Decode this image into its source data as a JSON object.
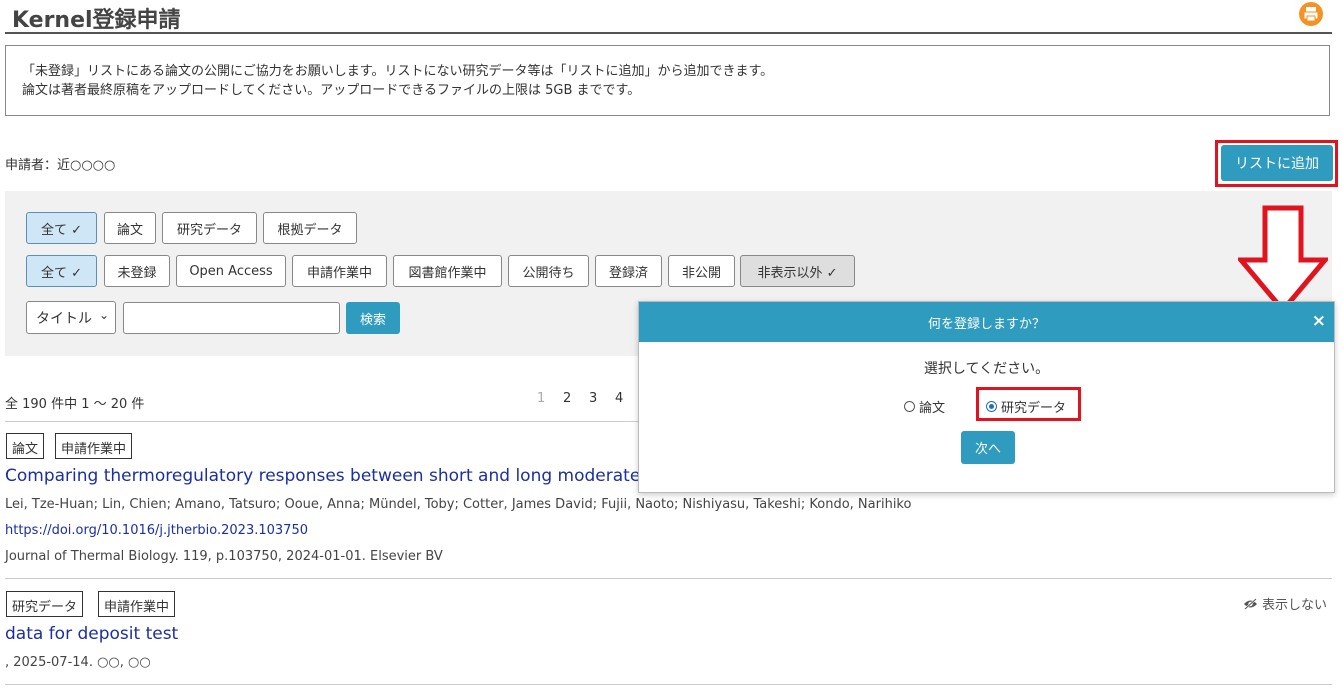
{
  "header": {
    "title": "Kernel登録申請",
    "print_icon": "print-icon"
  },
  "notice": {
    "line1": "「未登録」リストにある論文の公開にご協力をお願いします。リストにない研究データ等は「リストに追加」から追加できます。",
    "line2": "論文は著者最終原稿をアップロードしてください。アップロードできるファイルの上限は 5GB までです。"
  },
  "applicant": "申請者：近○○○○",
  "add_button": "リストに追加",
  "type_filters": [
    {
      "label": "全て ✓",
      "active": true
    },
    {
      "label": "論文",
      "active": false
    },
    {
      "label": "研究データ",
      "active": false
    },
    {
      "label": "根拠データ",
      "active": false
    }
  ],
  "status_filters": [
    {
      "label": "全て ✓",
      "active": true
    },
    {
      "label": "未登録"
    },
    {
      "label": "Open Access"
    },
    {
      "label": "申請作業中"
    },
    {
      "label": "図書館作業中"
    },
    {
      "label": "公開待ち"
    },
    {
      "label": "登録済"
    },
    {
      "label": "非公開"
    },
    {
      "label": "非表示以外 ✓"
    }
  ],
  "search": {
    "field_select": "タイトル",
    "button": "検索",
    "value": ""
  },
  "results": {
    "count": "全 190 件中 1 〜 20 件",
    "pages": [
      "1",
      "2",
      "3",
      "4"
    ]
  },
  "items": [
    {
      "tags": [
        "論文",
        "申請作業中"
      ],
      "title": "Comparing thermoregulatory responses between short and long moderate int",
      "authors": "Lei, Tze-Huan; Lin, Chien; Amano, Tatsuro; Ooue, Anna; Mündel, Toby; Cotter, James David; Fujii, Naoto; Nishiyasu, Takeshi; Kondo, Narihiko",
      "doi": "https://doi.org/10.1016/j.jtherbio.2023.103750",
      "citation": "Journal of Thermal Biology. 119, p.103750, 2024-01-01. Elsevier BV"
    },
    {
      "tags": [
        "研究データ",
        "申請作業中"
      ],
      "title": "data for deposit test",
      "citation": ", 2025-07-14. ○○, ○○",
      "hide_label": "表示しない"
    }
  ],
  "modal": {
    "title": "何を登録しますか？",
    "close": "×",
    "prompt": "選択してください。",
    "options": [
      {
        "label": "論文",
        "selected": false
      },
      {
        "label": "研究データ",
        "selected": true
      }
    ],
    "next_button": "次へ"
  },
  "colors": {
    "accent": "#2f9bbf",
    "highlight": "#e0141e",
    "link": "#1a2fa3"
  }
}
